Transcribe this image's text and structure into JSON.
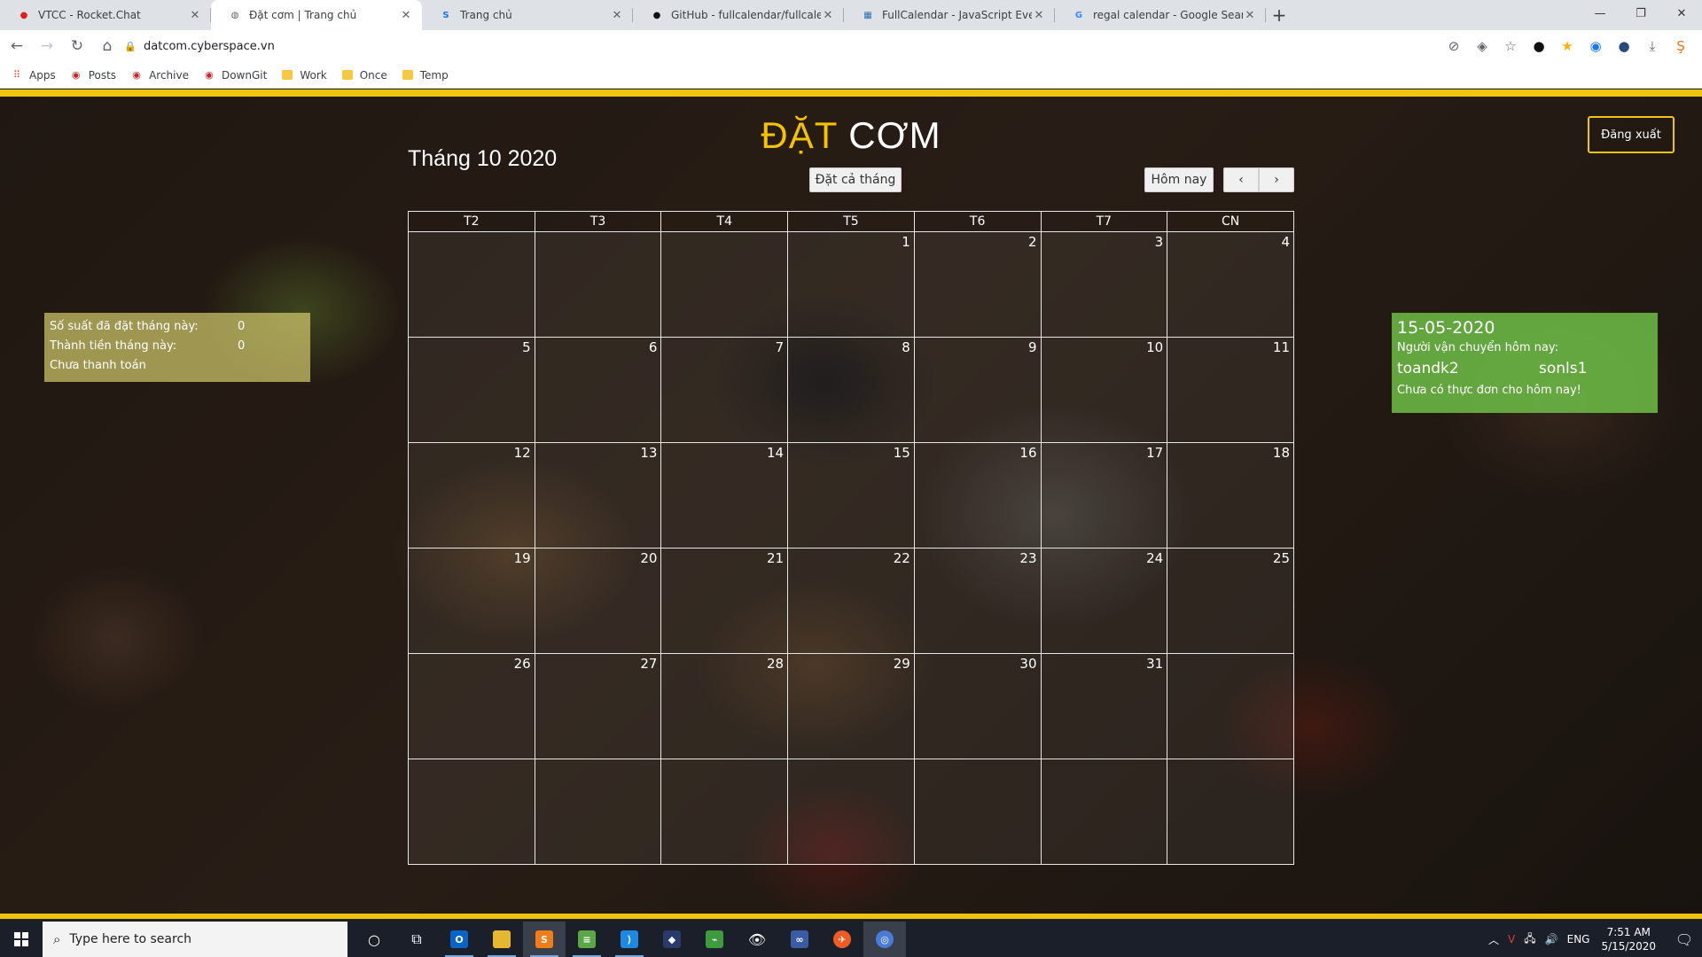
{
  "browser": {
    "tabs": [
      {
        "title": "VTCC - Rocket.Chat",
        "favicon": "rocketchat-icon",
        "color": "#e01e1e",
        "active": false
      },
      {
        "title": "Đặt cơm | Trang chủ",
        "favicon": "globe-icon",
        "color": "#5f6368",
        "active": true
      },
      {
        "title": "Trang chủ",
        "favicon": "s-logo-icon",
        "color": "#1a73e8",
        "active": false
      },
      {
        "title": "GitHub - fullcalendar/fullcalendar",
        "favicon": "github-icon",
        "color": "#111111",
        "active": false
      },
      {
        "title": "FullCalendar - JavaScript Event C",
        "favicon": "calendar-icon",
        "color": "#2c6db5",
        "active": false
      },
      {
        "title": "regal calendar - Google Search",
        "favicon": "google-icon",
        "color": "#4285f4",
        "active": false
      }
    ],
    "url": "datcom.cyberspace.vn",
    "bookmarks": [
      {
        "label": "Apps",
        "icon": "apps-grid-icon"
      },
      {
        "label": "Posts",
        "icon": "wordpress-icon"
      },
      {
        "label": "Archive",
        "icon": "wordpress-icon"
      },
      {
        "label": "DownGit",
        "icon": "wordpress-icon"
      },
      {
        "label": "Work",
        "icon": "folder-icon"
      },
      {
        "label": "Once",
        "icon": "folder-icon"
      },
      {
        "label": "Temp",
        "icon": "folder-icon"
      }
    ]
  },
  "page": {
    "title_part1": "ĐẶT",
    "title_part2": "CƠM",
    "logout": "Đăng xuất",
    "accent_color": "#f1c40f"
  },
  "stats": {
    "ordered_label": "Số suất đã đặt tháng này:",
    "ordered_value": "0",
    "amount_label": "Thành tiền tháng này:",
    "amount_value": "0",
    "status": "Chưa thanh toán"
  },
  "today": {
    "date": "15-05-2020",
    "shippers_label": "Người vận chuyển hôm nay:",
    "shipper1": "toandk2",
    "shipper2": "sonls1",
    "menu_note": "Chưa có thực đơn cho hôm nay!"
  },
  "calendar": {
    "month_title": "Tháng 10 2020",
    "book_month_btn": "Đặt cả tháng",
    "today_btn": "Hôm nay",
    "prev_btn": "‹",
    "next_btn": "›",
    "weekdays": [
      "T2",
      "T3",
      "T4",
      "T5",
      "T6",
      "T7",
      "CN"
    ],
    "weeks": [
      [
        "",
        "",
        "",
        "1",
        "2",
        "3",
        "4"
      ],
      [
        "5",
        "6",
        "7",
        "8",
        "9",
        "10",
        "11"
      ],
      [
        "12",
        "13",
        "14",
        "15",
        "16",
        "17",
        "18"
      ],
      [
        "19",
        "20",
        "21",
        "22",
        "23",
        "24",
        "25"
      ],
      [
        "26",
        "27",
        "28",
        "29",
        "30",
        "31",
        ""
      ],
      [
        "",
        "",
        "",
        "",
        "",
        "",
        ""
      ]
    ]
  },
  "taskbar": {
    "search_placeholder": "Type here to search",
    "language": "ENG",
    "time": "7:51 AM",
    "date": "5/15/2020"
  }
}
